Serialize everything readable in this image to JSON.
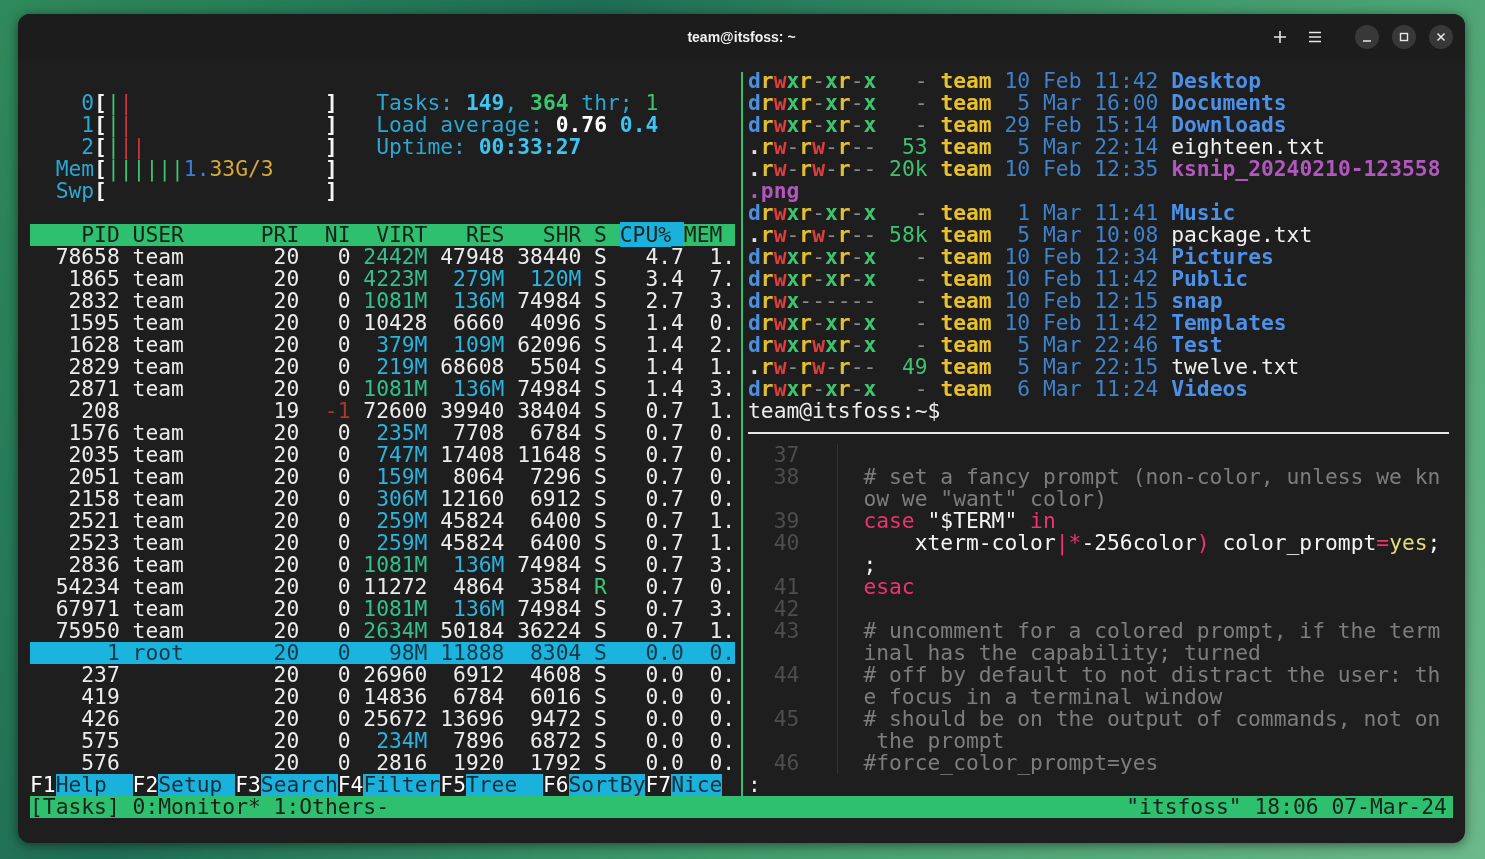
{
  "window": {
    "title": "team@itsfoss: ~"
  },
  "htop": {
    "meters": [
      {
        "label": "0",
        "open": "[",
        "parts": [
          {
            "text": "|",
            "kind": "user"
          },
          {
            "text": "|",
            "kind": "kernel"
          }
        ],
        "close": "]"
      },
      {
        "label": "1",
        "open": "[",
        "parts": [
          {
            "text": "|",
            "kind": "user"
          },
          {
            "text": "|",
            "kind": "kernel"
          }
        ],
        "close": "]"
      },
      {
        "label": "2",
        "open": "[",
        "parts": [
          {
            "text": "|",
            "kind": "user"
          },
          {
            "text": "||",
            "kind": "kernel"
          }
        ],
        "close": "]"
      },
      {
        "label": "Mem",
        "open": "[",
        "parts": [
          {
            "text": "||||||",
            "kind": "user"
          },
          {
            "text": "1.",
            "kind": "buffer"
          },
          {
            "text": "33G/3",
            "kind": "cache"
          }
        ],
        "close": "]"
      },
      {
        "label": "Swp",
        "open": "[",
        "close": "]"
      }
    ],
    "summary": [
      [
        {
          "text": "Tasks: ",
          "kind": "label"
        },
        {
          "text": "149",
          "kind": "number"
        },
        {
          "text": ", ",
          "kind": "label"
        },
        {
          "text": "364",
          "kind": "threads"
        },
        {
          "text": " thr; ",
          "kind": "label"
        },
        {
          "text": "1",
          "kind": "running"
        }
      ],
      [
        {
          "text": "Load average: ",
          "kind": "label"
        },
        {
          "text": "0.76 ",
          "kind": "load1"
        },
        {
          "text": "0.4",
          "kind": "number"
        }
      ],
      [
        {
          "text": "Uptime: ",
          "kind": "label"
        },
        {
          "text": "00:33:27",
          "kind": "number"
        }
      ]
    ],
    "columns": [
      {
        "label": "PID",
        "selected": false
      },
      {
        "label": "USER",
        "selected": false
      },
      {
        "label": "PRI",
        "selected": false
      },
      {
        "label": "NI",
        "selected": false
      },
      {
        "label": "VIRT",
        "selected": false
      },
      {
        "label": "RES",
        "selected": false
      },
      {
        "label": "SHR",
        "selected": false
      },
      {
        "label": "S",
        "selected": false
      },
      {
        "label": "CPU%_",
        "selected": true
      },
      {
        "label": "MEM",
        "selected": false
      }
    ],
    "rows": [
      {
        "pid": "78658",
        "user": "team",
        "pri": "20",
        "ni": "0",
        "virt": "2442M",
        "res": "47948",
        "shr": "38440",
        "s": "S",
        "cpu": "4.7",
        "mem": "1.",
        "niced": false,
        "running": false,
        "selected": false
      },
      {
        "pid": "1865",
        "user": "team",
        "pri": "20",
        "ni": "0",
        "virt": "4223M",
        "res": "279M",
        "shr": "120M",
        "s": "S",
        "cpu": "3.4",
        "mem": "7.",
        "niced": false,
        "running": false,
        "selected": false
      },
      {
        "pid": "2832",
        "user": "team",
        "pri": "20",
        "ni": "0",
        "virt": "1081M",
        "res": "136M",
        "shr": "74984",
        "s": "S",
        "cpu": "2.7",
        "mem": "3.",
        "niced": false,
        "running": false,
        "selected": false
      },
      {
        "pid": "1595",
        "user": "team",
        "pri": "20",
        "ni": "0",
        "virt": "10428",
        "res": "6660",
        "shr": "4096",
        "s": "S",
        "cpu": "1.4",
        "mem": "0.",
        "niced": false,
        "running": false,
        "selected": false
      },
      {
        "pid": "1628",
        "user": "team",
        "pri": "20",
        "ni": "0",
        "virt": "379M",
        "res": "109M",
        "shr": "62096",
        "s": "S",
        "cpu": "1.4",
        "mem": "2.",
        "niced": false,
        "running": false,
        "selected": false
      },
      {
        "pid": "2829",
        "user": "team",
        "pri": "20",
        "ni": "0",
        "virt": "219M",
        "res": "68608",
        "shr": "5504",
        "s": "S",
        "cpu": "1.4",
        "mem": "1.",
        "niced": false,
        "running": false,
        "selected": false
      },
      {
        "pid": "2871",
        "user": "team",
        "pri": "20",
        "ni": "0",
        "virt": "1081M",
        "res": "136M",
        "shr": "74984",
        "s": "S",
        "cpu": "1.4",
        "mem": "3.",
        "niced": false,
        "running": false,
        "selected": false
      },
      {
        "pid": "208",
        "pri": "19",
        "ni": "-1",
        "virt": "72600",
        "res": "39940",
        "shr": "38404",
        "s": "S",
        "cpu": "0.7",
        "mem": "1.",
        "niced": true,
        "running": false,
        "selected": false
      },
      {
        "pid": "1576",
        "user": "team",
        "pri": "20",
        "ni": "0",
        "virt": "235M",
        "res": "7708",
        "shr": "6784",
        "s": "S",
        "cpu": "0.7",
        "mem": "0.",
        "niced": false,
        "running": false,
        "selected": false
      },
      {
        "pid": "2035",
        "user": "team",
        "pri": "20",
        "ni": "0",
        "virt": "747M",
        "res": "17408",
        "shr": "11648",
        "s": "S",
        "cpu": "0.7",
        "mem": "0.",
        "niced": false,
        "running": false,
        "selected": false
      },
      {
        "pid": "2051",
        "user": "team",
        "pri": "20",
        "ni": "0",
        "virt": "159M",
        "res": "8064",
        "shr": "7296",
        "s": "S",
        "cpu": "0.7",
        "mem": "0.",
        "niced": false,
        "running": false,
        "selected": false
      },
      {
        "pid": "2158",
        "user": "team",
        "pri": "20",
        "ni": "0",
        "virt": "306M",
        "res": "12160",
        "shr": "6912",
        "s": "S",
        "cpu": "0.7",
        "mem": "0.",
        "niced": false,
        "running": false,
        "selected": false
      },
      {
        "pid": "2521",
        "user": "team",
        "pri": "20",
        "ni": "0",
        "virt": "259M",
        "res": "45824",
        "shr": "6400",
        "s": "S",
        "cpu": "0.7",
        "mem": "1.",
        "niced": false,
        "running": false,
        "selected": false
      },
      {
        "pid": "2523",
        "user": "team",
        "pri": "20",
        "ni": "0",
        "virt": "259M",
        "res": "45824",
        "shr": "6400",
        "s": "S",
        "cpu": "0.7",
        "mem": "1.",
        "niced": false,
        "running": false,
        "selected": false
      },
      {
        "pid": "2836",
        "user": "team",
        "pri": "20",
        "ni": "0",
        "virt": "1081M",
        "res": "136M",
        "shr": "74984",
        "s": "S",
        "cpu": "0.7",
        "mem": "3.",
        "niced": false,
        "running": false,
        "selected": false
      },
      {
        "pid": "54234",
        "user": "team",
        "pri": "20",
        "ni": "0",
        "virt": "11272",
        "res": "4864",
        "shr": "3584",
        "s": "R",
        "cpu": "0.7",
        "mem": "0.",
        "niced": false,
        "running": true,
        "selected": false
      },
      {
        "pid": "67971",
        "user": "team",
        "pri": "20",
        "ni": "0",
        "virt": "1081M",
        "res": "136M",
        "shr": "74984",
        "s": "S",
        "cpu": "0.7",
        "mem": "3.",
        "niced": false,
        "running": false,
        "selected": false
      },
      {
        "pid": "75950",
        "user": "team",
        "pri": "20",
        "ni": "0",
        "virt": "2634M",
        "res": "50184",
        "shr": "36224",
        "s": "S",
        "cpu": "0.7",
        "mem": "1.",
        "niced": false,
        "running": false,
        "selected": false
      },
      {
        "pid": "1",
        "user": "root",
        "pri": "20",
        "ni": "0",
        "virt": "98M",
        "res": "11888",
        "shr": "8304",
        "s": "S",
        "cpu": "0.0",
        "mem": "0.",
        "niced": false,
        "running": false,
        "selected": true
      },
      {
        "pid": "237",
        "pri": "20",
        "ni": "0",
        "virt": "26960",
        "res": "6912",
        "shr": "4608",
        "s": "S",
        "cpu": "0.0",
        "mem": "0.",
        "niced": false,
        "running": false,
        "selected": false
      },
      {
        "pid": "419",
        "pri": "20",
        "ni": "0",
        "virt": "14836",
        "res": "6784",
        "shr": "6016",
        "s": "S",
        "cpu": "0.0",
        "mem": "0.",
        "niced": false,
        "running": false,
        "selected": false
      },
      {
        "pid": "426",
        "pri": "20",
        "ni": "0",
        "virt": "25672",
        "res": "13696",
        "shr": "9472",
        "s": "S",
        "cpu": "0.0",
        "mem": "0.",
        "niced": false,
        "running": false,
        "selected": false
      },
      {
        "pid": "575",
        "pri": "20",
        "ni": "0",
        "virt": "234M",
        "res": "7896",
        "shr": "6872",
        "s": "S",
        "cpu": "0.0",
        "mem": "0.",
        "niced": false,
        "running": false,
        "selected": false
      },
      {
        "pid": "576",
        "pri": "20",
        "ni": "0",
        "virt": "2816",
        "res": "1920",
        "shr": "1792",
        "s": "S",
        "cpu": "0.0",
        "mem": "0.",
        "niced": false,
        "running": false,
        "selected": false
      }
    ],
    "function_keys": [
      {
        "key": "F1",
        "label": "Help"
      },
      {
        "key": "F2",
        "label": "Setup"
      },
      {
        "key": "F3",
        "label": "Search"
      },
      {
        "key": "F4",
        "label": "Filter"
      },
      {
        "key": "F5",
        "label": "Tree"
      },
      {
        "key": "F6",
        "label": "SortBy"
      },
      {
        "key": "F7",
        "label": "Nice"
      }
    ]
  },
  "listing": {
    "rows": [
      {
        "perms": "drwxr-xr-x",
        "size": "-",
        "user": "team",
        "day": "10",
        "month": "Feb",
        "time": "11:42",
        "name": "Desktop",
        "kind": "dir"
      },
      {
        "perms": "drwxr-xr-x",
        "size": "-",
        "user": "team",
        "day": "5",
        "month": "Mar",
        "time": "16:00",
        "name": "Documents",
        "kind": "dir"
      },
      {
        "perms": "drwxr-xr-x",
        "size": "-",
        "user": "team",
        "day": "29",
        "month": "Feb",
        "time": "15:14",
        "name": "Downloads",
        "kind": "dir"
      },
      {
        "perms": ".rw-rw-r--",
        "size": "53",
        "user": "team",
        "day": "5",
        "month": "Mar",
        "time": "22:14",
        "name": "eighteen.txt",
        "kind": "file"
      },
      {
        "perms": ".rw-rw-r--",
        "size": "20k",
        "user": "team",
        "day": "10",
        "month": "Feb",
        "time": "12:35",
        "name": "ksnip_20240210-123558",
        "name_continued": ".png",
        "kind": "image"
      },
      {
        "perms": "drwxr-xr-x",
        "size": "-",
        "user": "team",
        "day": "1",
        "month": "Mar",
        "time": "11:41",
        "name": "Music",
        "kind": "dir"
      },
      {
        "perms": ".rw-rw-r--",
        "size": "58k",
        "user": "team",
        "day": "5",
        "month": "Mar",
        "time": "10:08",
        "name": "package.txt",
        "kind": "file"
      },
      {
        "perms": "drwxr-xr-x",
        "size": "-",
        "user": "team",
        "day": "10",
        "month": "Feb",
        "time": "12:34",
        "name": "Pictures",
        "kind": "dir"
      },
      {
        "perms": "drwxr-xr-x",
        "size": "-",
        "user": "team",
        "day": "10",
        "month": "Feb",
        "time": "11:42",
        "name": "Public",
        "kind": "dir"
      },
      {
        "perms": "drwx------",
        "size": "-",
        "user": "team",
        "day": "10",
        "month": "Feb",
        "time": "12:15",
        "name": "snap",
        "kind": "dir"
      },
      {
        "perms": "drwxr-xr-x",
        "size": "-",
        "user": "team",
        "day": "10",
        "month": "Feb",
        "time": "11:42",
        "name": "Templates",
        "kind": "dir"
      },
      {
        "perms": "drwxrwxr-x",
        "size": "-",
        "user": "team",
        "day": "5",
        "month": "Mar",
        "time": "22:46",
        "name": "Test",
        "kind": "dir"
      },
      {
        "perms": ".rw-rw-r--",
        "size": "49",
        "user": "team",
        "day": "5",
        "month": "Mar",
        "time": "22:15",
        "name": "twelve.txt",
        "kind": "file"
      },
      {
        "perms": "drwxr-xr-x",
        "size": "-",
        "user": "team",
        "day": "6",
        "month": "Mar",
        "time": "11:24",
        "name": "Videos",
        "kind": "dir"
      }
    ],
    "prompt": "team@itsfoss:~$"
  },
  "editor": {
    "lines": [
      {
        "number": "37"
      },
      {
        "number": "38",
        "segments": [
          {
            "text": "# set a fancy prompt (non-color, unless we know we \"want\" color)",
            "kind": "comment"
          }
        ]
      },
      {
        "number": "39",
        "segments": [
          {
            "text": "case",
            "kind": "keyword"
          },
          {
            "text": " \"$TERM\" ",
            "kind": "plain"
          },
          {
            "text": "in",
            "kind": "keyword"
          }
        ]
      },
      {
        "number": "40",
        "segments": [
          {
            "text": "    xterm-color",
            "kind": "plain"
          },
          {
            "text": "|*",
            "kind": "operator"
          },
          {
            "text": "-256color",
            "kind": "plain"
          },
          {
            "text": ")",
            "kind": "operator"
          },
          {
            "text": " color_prompt",
            "kind": "plain"
          },
          {
            "text": "=",
            "kind": "operator"
          },
          {
            "text": "yes",
            "kind": "value"
          },
          {
            "text": ";;",
            "kind": "plain"
          }
        ]
      },
      {
        "number": "41",
        "segments": [
          {
            "text": "esac",
            "kind": "keyword"
          }
        ]
      },
      {
        "number": "42"
      },
      {
        "number": "43",
        "segments": [
          {
            "text": "# uncomment for a colored prompt, if the terminal has the capability; turned",
            "kind": "comment"
          }
        ]
      },
      {
        "number": "44",
        "segments": [
          {
            "text": "# off by default to not distract the user: the focus in a terminal window",
            "kind": "comment"
          }
        ]
      },
      {
        "number": "45",
        "segments": [
          {
            "text": "# should be on the output of commands, not on the prompt",
            "kind": "comment"
          }
        ]
      },
      {
        "number": "46",
        "segments": [
          {
            "text": "#force_color_prompt=yes",
            "kind": "comment"
          }
        ]
      }
    ],
    "command_line": ":"
  },
  "status_bar": {
    "session": "[Tasks]",
    "windows": [
      "0:Monitor*",
      "1:Others-"
    ],
    "right": "\"itsfoss\" 18:06 07-Mar-24"
  }
}
